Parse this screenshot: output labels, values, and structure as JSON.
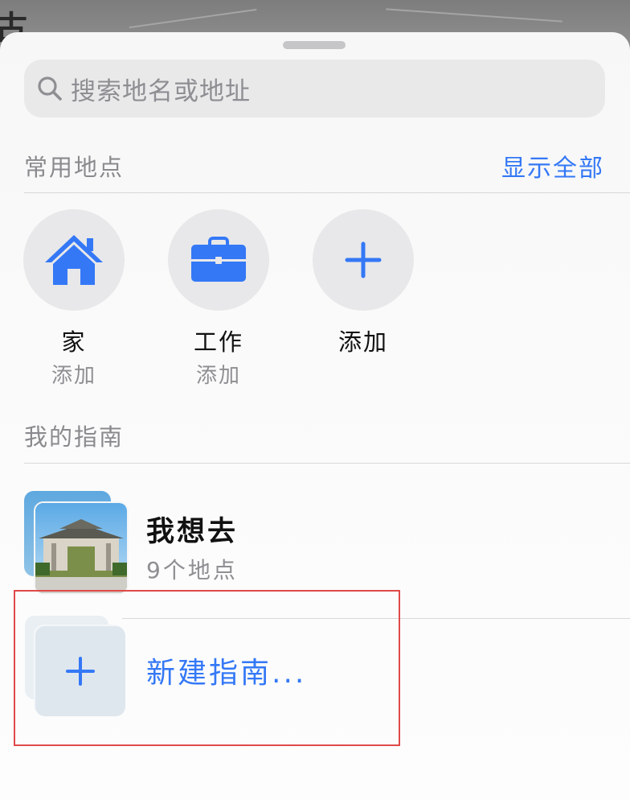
{
  "search": {
    "placeholder": "搜索地名或地址"
  },
  "favorites": {
    "title": "常用地点",
    "show_all": "显示全部",
    "items": [
      {
        "name": "家",
        "sub": "添加",
        "icon": "house-icon"
      },
      {
        "name": "工作",
        "sub": "添加",
        "icon": "briefcase-icon"
      },
      {
        "name": "添加",
        "sub": "",
        "icon": "plus-icon"
      }
    ]
  },
  "guides": {
    "title": "我的指南",
    "items": [
      {
        "name": "我想去",
        "sub": "9个地点"
      }
    ],
    "new_label": "新建指南..."
  },
  "colors": {
    "accent": "#3478f6",
    "highlight_border": "#e04a4a"
  }
}
